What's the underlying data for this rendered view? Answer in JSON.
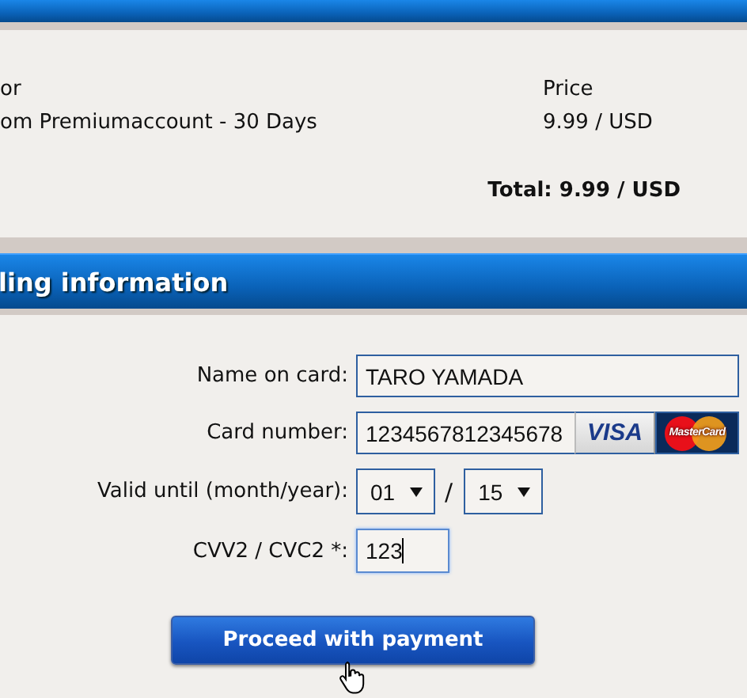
{
  "order": {
    "columns": [
      "or",
      "Price"
    ],
    "items": [
      {
        "product": "om Premiumaccount - 30 Days",
        "price": "9.99 / USD"
      }
    ],
    "total": "Total: 9.99 / USD"
  },
  "billing": {
    "title": "ling information",
    "fields": [
      {
        "kind": "text",
        "label": "Name on card:",
        "value": "TARO YAMADA",
        "focused": false
      },
      {
        "kind": "card",
        "label": "Card number:",
        "value": "1234567812345678",
        "brands": [
          "VISA",
          "MasterCard"
        ]
      },
      {
        "kind": "expiry",
        "label": "Valid until (month/year):",
        "month": "01",
        "separator": "/",
        "year": "15"
      },
      {
        "kind": "cvv",
        "label": "CVV2 / CVC2 *:",
        "value": "123",
        "focused": true
      }
    ],
    "submit": "Proceed with payment"
  }
}
